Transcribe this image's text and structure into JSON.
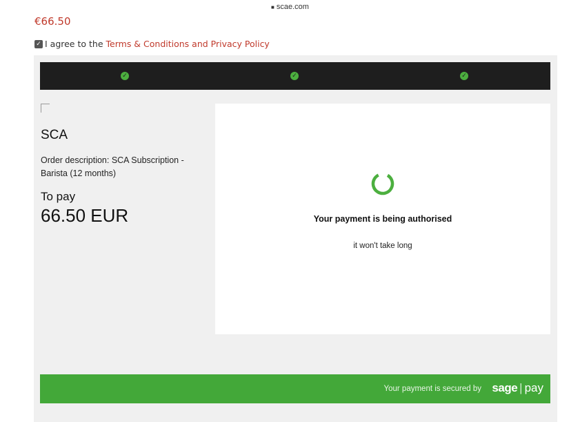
{
  "url_bar": {
    "domain": "scae.com"
  },
  "summary": {
    "price": "€66.50",
    "agree_text": "I agree to the",
    "agree_link": "Terms & Conditions and Privacy Policy"
  },
  "steps": {
    "count": 3,
    "status_color": "#4caf3f"
  },
  "order": {
    "merchant": "SCA",
    "description": "Order description: SCA Subscription - Barista (12 months)",
    "to_pay_label": "To pay",
    "amount": "66.50 EUR"
  },
  "auth": {
    "title": "Your payment is being authorised",
    "subtitle": "it won't take long"
  },
  "footer": {
    "secured_text": "Your payment is secured by",
    "logo_left": "sage",
    "logo_right": "pay",
    "accent": "#43a839"
  }
}
